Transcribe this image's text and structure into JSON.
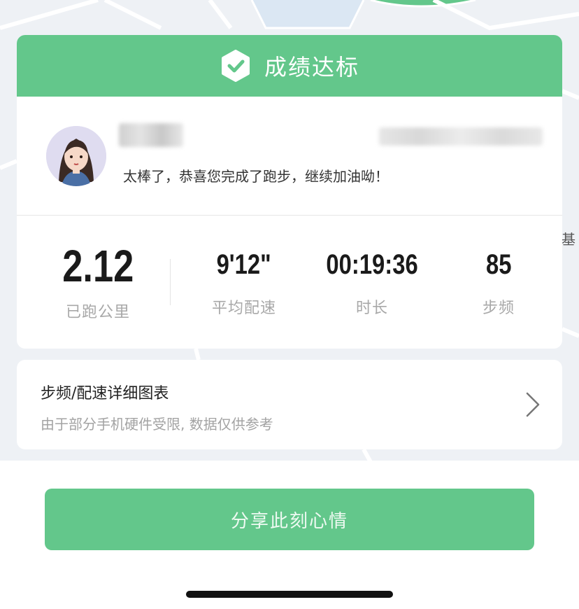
{
  "map": {
    "label": "基"
  },
  "banner": {
    "title": "成绩达标",
    "icon": "check-badge-icon"
  },
  "user": {
    "message": "太棒了，恭喜您完成了跑步，继续加油呦！",
    "avatar_icon": "avatar-girl-icon"
  },
  "stats": {
    "distance": {
      "value": "2.12",
      "label": "已跑公里"
    },
    "pace": {
      "value": "9'12\"",
      "label": "平均配速"
    },
    "duration": {
      "value": "00:19:36",
      "label": "时长"
    },
    "cadence": {
      "value": "85",
      "label": "步频"
    }
  },
  "chart_link": {
    "title": "步频/配速详细图表",
    "subtitle": "由于部分手机硬件受限, 数据仅供参考",
    "icon": "chevron-right-icon"
  },
  "share": {
    "label": "分享此刻心情"
  },
  "colors": {
    "accent": "#63c78b",
    "text": "#1a1a1a",
    "muted": "#a8a8a8"
  }
}
